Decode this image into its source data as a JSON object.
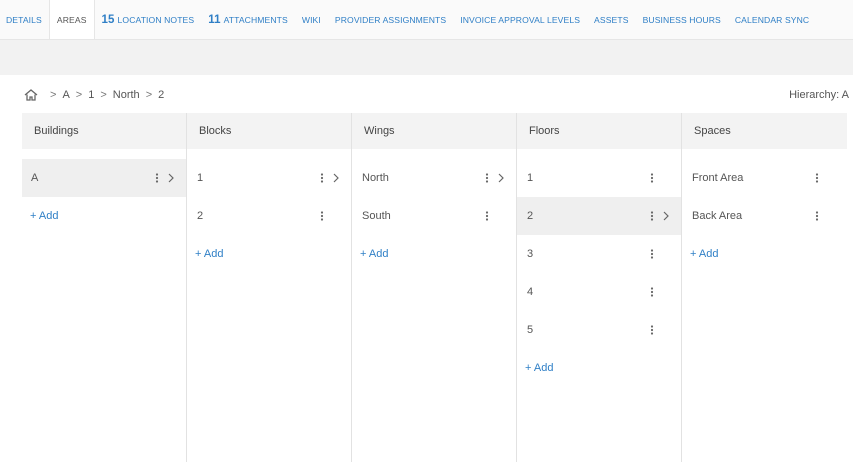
{
  "tabs": [
    {
      "label": "DETAILS",
      "count": "",
      "active": false
    },
    {
      "label": "AREAS",
      "count": "",
      "active": true
    },
    {
      "label": "LOCATION NOTES",
      "count": "15",
      "active": false
    },
    {
      "label": "ATTACHMENTS",
      "count": "11",
      "active": false
    },
    {
      "label": "WIKI",
      "count": "",
      "active": false
    },
    {
      "label": "PROVIDER ASSIGNMENTS",
      "count": "",
      "active": false
    },
    {
      "label": "INVOICE APPROVAL LEVELS",
      "count": "",
      "active": false
    },
    {
      "label": "ASSETS",
      "count": "",
      "active": false
    },
    {
      "label": "BUSINESS HOURS",
      "count": "",
      "active": false
    },
    {
      "label": "CALENDAR SYNC",
      "count": "",
      "active": false
    }
  ],
  "breadcrumb": {
    "icon": "home-icon",
    "items": [
      "A",
      "1",
      "North",
      "2"
    ],
    "separator": ">"
  },
  "hierarchy_label": "Hierarchy: A",
  "columns": [
    {
      "title": "Buildings",
      "rows": [
        {
          "label": "A",
          "selected": true,
          "has_children": true
        }
      ],
      "add_label": "+ Add"
    },
    {
      "title": "Blocks",
      "rows": [
        {
          "label": "1",
          "selected": false,
          "has_children": true
        },
        {
          "label": "2",
          "selected": false,
          "has_children": false
        }
      ],
      "add_label": "+ Add"
    },
    {
      "title": "Wings",
      "rows": [
        {
          "label": "North",
          "selected": false,
          "has_children": true
        },
        {
          "label": "South",
          "selected": false,
          "has_children": false
        }
      ],
      "add_label": "+ Add"
    },
    {
      "title": "Floors",
      "rows": [
        {
          "label": "1",
          "selected": false,
          "has_children": false
        },
        {
          "label": "2",
          "selected": true,
          "has_children": true
        },
        {
          "label": "3",
          "selected": false,
          "has_children": false
        },
        {
          "label": "4",
          "selected": false,
          "has_children": false
        },
        {
          "label": "5",
          "selected": false,
          "has_children": false
        }
      ],
      "add_label": "+ Add"
    },
    {
      "title": "Spaces",
      "rows": [
        {
          "label": "Front Area",
          "selected": false,
          "has_children": false
        },
        {
          "label": "Back Area",
          "selected": false,
          "has_children": false
        }
      ],
      "add_label": "+ Add"
    }
  ],
  "icons": {
    "menu": "kebab-menu-icon",
    "arrow": "chevron-right-icon"
  },
  "colors": {
    "accent": "#2f7fc6",
    "selected_row": "#efefef",
    "header_bg": "#f3f3f3"
  }
}
